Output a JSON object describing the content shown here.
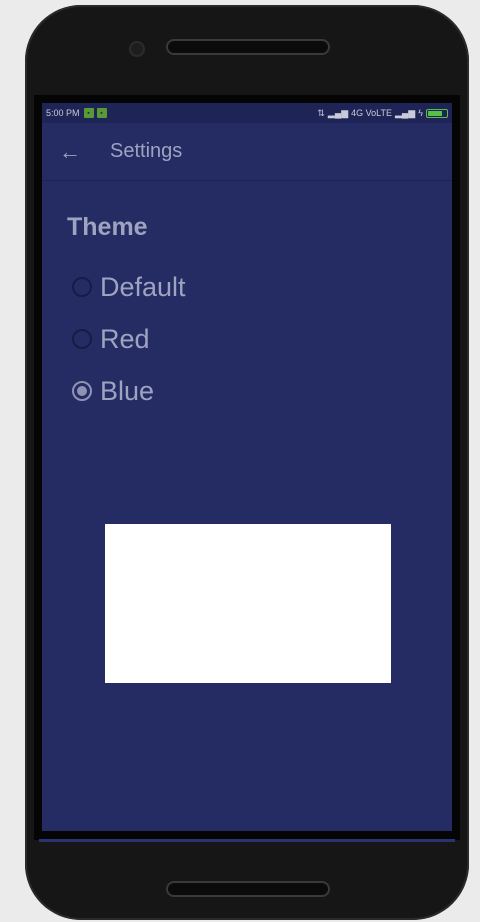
{
  "statusbar": {
    "time": "5:00 PM",
    "network": "4G VoLTE"
  },
  "appbar": {
    "title": "Settings",
    "back_icon": "arrow-left-icon"
  },
  "theme": {
    "title": "Theme",
    "options": [
      {
        "label": "Default",
        "selected": false
      },
      {
        "label": "Red",
        "selected": false
      },
      {
        "label": "Blue",
        "selected": true
      }
    ]
  },
  "colors": {
    "screen_bg": "#242c63",
    "text": "#9ea3c0",
    "radio_selected": "#8e93b4"
  }
}
